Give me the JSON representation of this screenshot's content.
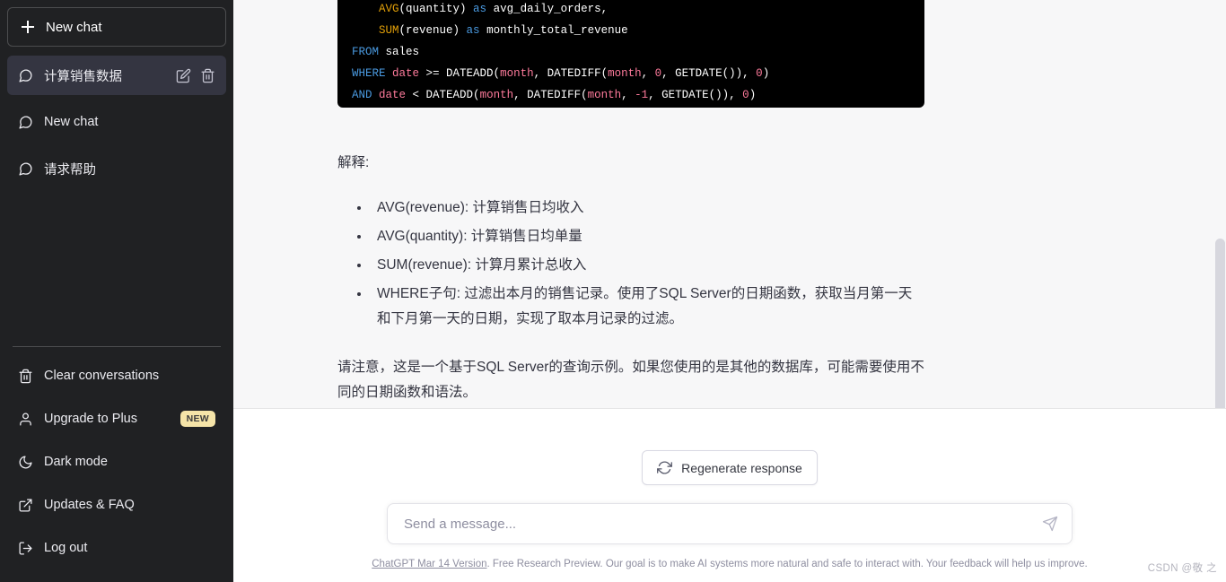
{
  "sidebar": {
    "new_chat_label": "New chat",
    "chats": [
      {
        "label": "计算销售数据",
        "active": true,
        "edit_icon": "pencil-icon",
        "delete_icon": "trash-icon"
      },
      {
        "label": "New chat",
        "active": false
      },
      {
        "label": "请求帮助",
        "active": false
      }
    ],
    "menu": [
      {
        "label": "Clear conversations",
        "icon": "trash-icon"
      },
      {
        "label": "Upgrade to Plus",
        "icon": "user-icon",
        "badge": "NEW"
      },
      {
        "label": "Dark mode",
        "icon": "moon-icon"
      },
      {
        "label": "Updates & FAQ",
        "icon": "external-link-icon"
      },
      {
        "label": "Log out",
        "icon": "logout-icon"
      }
    ],
    "colors": {
      "background": "#202123",
      "active_item": "#343541",
      "badge": "#f5e4a8"
    }
  },
  "message": {
    "code": {
      "language": "sql",
      "lines": [
        "    AVG(quantity) as avg_daily_orders,",
        "    SUM(revenue) as monthly_total_revenue",
        "FROM sales",
        "WHERE date >= DATEADD(month, DATEDIFF(month, 0, GETDATE()), 0)",
        "AND date < DATEADD(month, DATEDIFF(month, -1, GETDATE()), 0)"
      ],
      "colors": {
        "background": "#000000",
        "keyword": "#4a9ae1",
        "function": "#e3a008",
        "identifier": "#ff7b9c",
        "plain": "#ffffff"
      }
    },
    "explain_heading": "解释:",
    "bullets": [
      "AVG(revenue): 计算销售日均收入",
      "AVG(quantity): 计算销售日均单量",
      "SUM(revenue): 计算月累计总收入",
      "WHERE子句: 过滤出本月的销售记录。使用了SQL Server的日期函数，获取当月第一天和下月第一天的日期，实现了取本月记录的过滤。"
    ],
    "note": "请注意，这是一个基于SQL Server的查询示例。如果您使用的是其他的数据库，可能需要使用不同的日期函数和语法。"
  },
  "composer": {
    "regenerate_label": "Regenerate response",
    "regenerate_icon": "refresh-icon",
    "input_placeholder": "Send a message...",
    "input_value": "",
    "send_icon": "send-icon"
  },
  "footer": {
    "link_text": "ChatGPT Mar 14 Version",
    "rest_text": ". Free Research Preview. Our goal is to make AI systems more natural and safe to interact with. Your feedback will help us improve."
  },
  "watermark": "CSDN @敬 之"
}
